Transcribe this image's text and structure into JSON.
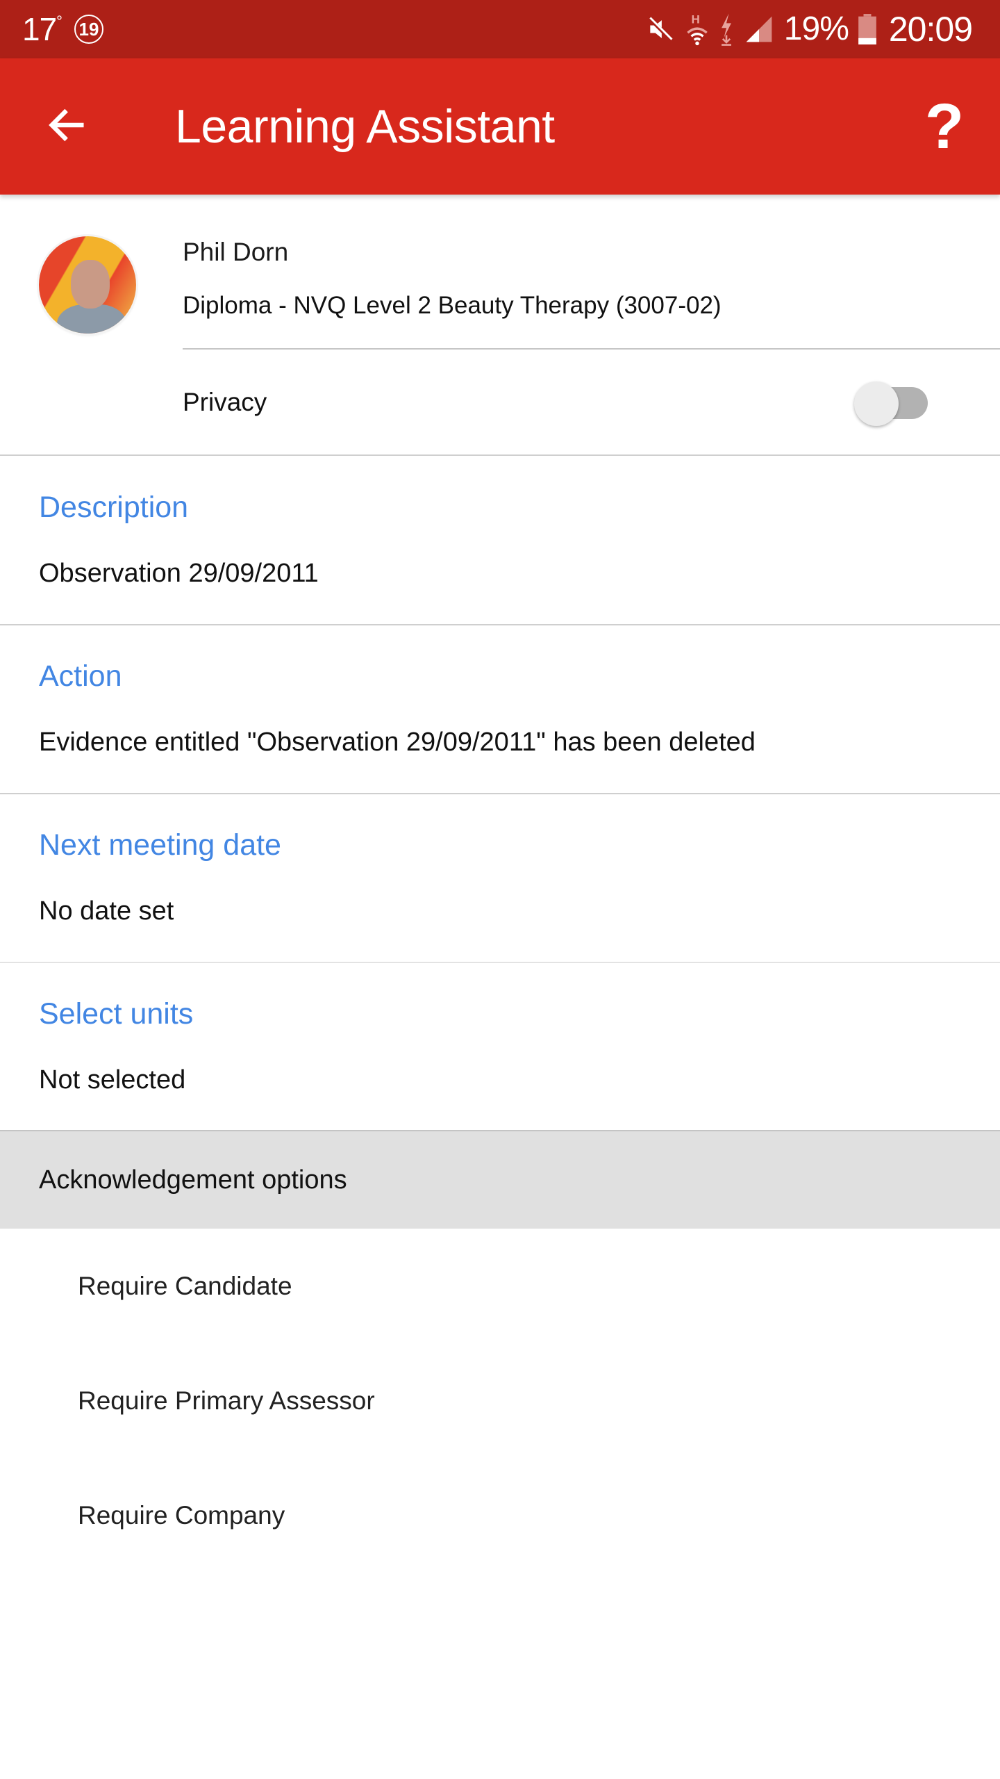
{
  "status_bar": {
    "temperature": "17",
    "temperature_unit": "°",
    "notification_badge": "19",
    "icons": [
      "mute-icon",
      "wifi-icon",
      "charging-icon",
      "signal-icon",
      "battery-icon"
    ],
    "battery_percent": "19%",
    "battery_level": 0.19,
    "time": "20:09",
    "background_color": "#ad2017"
  },
  "app_bar": {
    "title": "Learning Assistant",
    "back_icon": "arrow-left-icon",
    "help_label": "?",
    "background_color": "#d8281c"
  },
  "profile": {
    "name": "Phil Dorn",
    "course": "Diploma - NVQ Level 2 Beauty Therapy (3007-02)",
    "privacy_label": "Privacy",
    "privacy_enabled": false
  },
  "sections": [
    {
      "label": "Description",
      "value": "Observation 29/09/2011"
    },
    {
      "label": "Action",
      "value": "Evidence entitled \"Observation 29/09/2011\" has been deleted"
    },
    {
      "label": "Next meeting date",
      "value": "No date set"
    },
    {
      "label": "Select units",
      "value": "Not selected"
    }
  ],
  "acknowledgement": {
    "title": "Acknowledgement options",
    "options": [
      {
        "label": "Require Candidate"
      },
      {
        "label": "Require Primary Assessor"
      },
      {
        "label": "Require Company"
      }
    ]
  },
  "colors": {
    "accent_label": "#4286e3",
    "section_header_bg": "#e0e0e0"
  }
}
